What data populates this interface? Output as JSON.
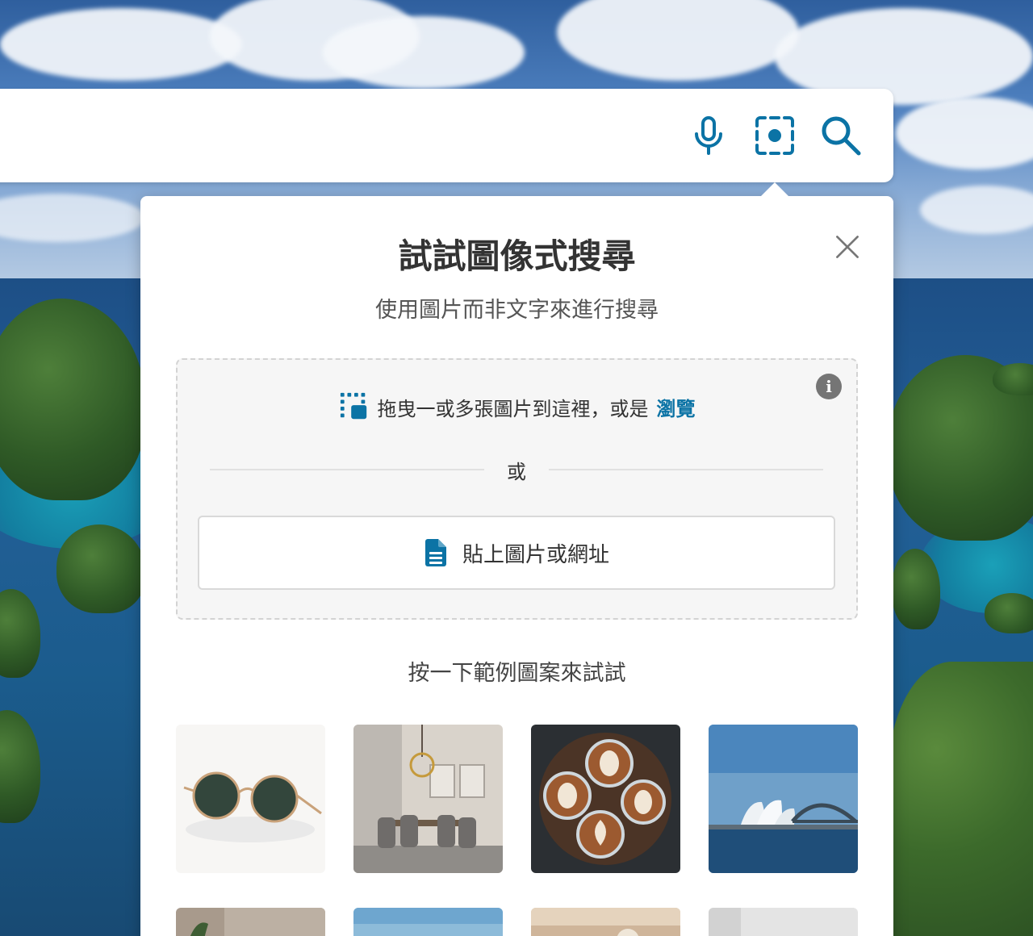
{
  "search": {
    "mic_icon": "microphone-icon",
    "visual_search_icon": "visual-search-icon",
    "search_icon": "search-icon",
    "accent_color": "#0b73a5"
  },
  "popup": {
    "title": "試試圖像式搜尋",
    "subtitle": "使用圖片而非文字來進行搜尋",
    "dropzone": {
      "drag_text": "拖曳一或多張圖片到這裡，或是",
      "browse_link": "瀏覽",
      "or_text": "或",
      "paste_button": "貼上圖片或網址"
    },
    "examples_label": "按一下範例圖案來試試",
    "examples": [
      {
        "subject": "sunglasses"
      },
      {
        "subject": "dining-room"
      },
      {
        "subject": "latte-art"
      },
      {
        "subject": "sydney-opera-house"
      }
    ]
  }
}
